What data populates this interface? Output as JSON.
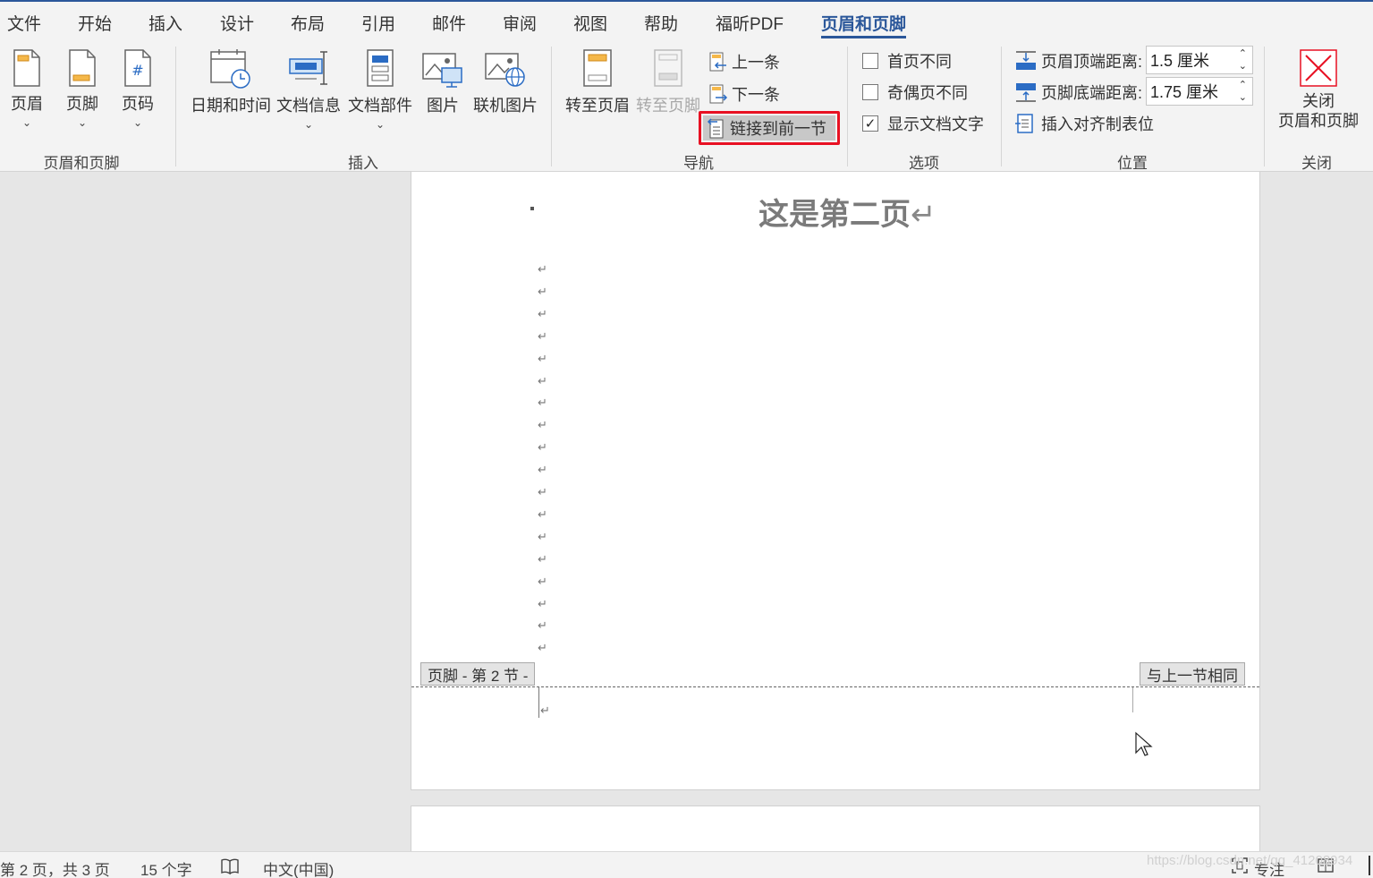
{
  "tabs": [
    "文件",
    "开始",
    "插入",
    "设计",
    "布局",
    "引用",
    "邮件",
    "审阅",
    "视图",
    "帮助",
    "福昕PDF",
    "页眉和页脚"
  ],
  "active_tab": "页眉和页脚",
  "ribbon": {
    "header_footer_group": {
      "label": "页眉和页脚",
      "header": "页眉",
      "footer": "页脚",
      "page_number": "页码"
    },
    "insert_group": {
      "label": "插入",
      "date_time": "日期和时间",
      "doc_info": "文档信息",
      "doc_parts": "文档部件",
      "picture": "图片",
      "online_picture": "联机图片"
    },
    "navigation_group": {
      "label": "导航",
      "goto_header": "转至页眉",
      "goto_footer": "转至页脚",
      "previous": "上一条",
      "next": "下一条",
      "link_previous": "链接到前一节"
    },
    "options_group": {
      "label": "选项",
      "different_first": "首页不同",
      "different_odd_even": "奇偶页不同",
      "show_doc_text": "显示文档文字",
      "different_first_checked": false,
      "different_odd_even_checked": false,
      "show_doc_text_checked": true
    },
    "position_group": {
      "label": "位置",
      "header_top_label": "页眉顶端距离:",
      "header_top_value": "1.5 厘米",
      "footer_bottom_label": "页脚底端距离:",
      "footer_bottom_value": "1.75 厘米",
      "insert_align_tab": "插入对齐制表位"
    },
    "close_group": {
      "label": "关闭",
      "close_line1": "关闭",
      "close_line2": "页眉和页脚"
    }
  },
  "document": {
    "heading": "这是第二页",
    "paragraph_mark": "↵",
    "footer_tag": "页脚 - 第 2 节 -",
    "same_as_previous": "与上一节相同"
  },
  "status_bar": {
    "page_info": "第 2 页，共 3 页",
    "word_count": "15 个字",
    "language": "中文(中国)",
    "focus": "专注"
  },
  "watermark": "https://blog.csdn.net/qq_41208934",
  "colors": {
    "accent": "#2b579a",
    "highlight_border": "#e81123",
    "close_icon": "#e81123"
  }
}
